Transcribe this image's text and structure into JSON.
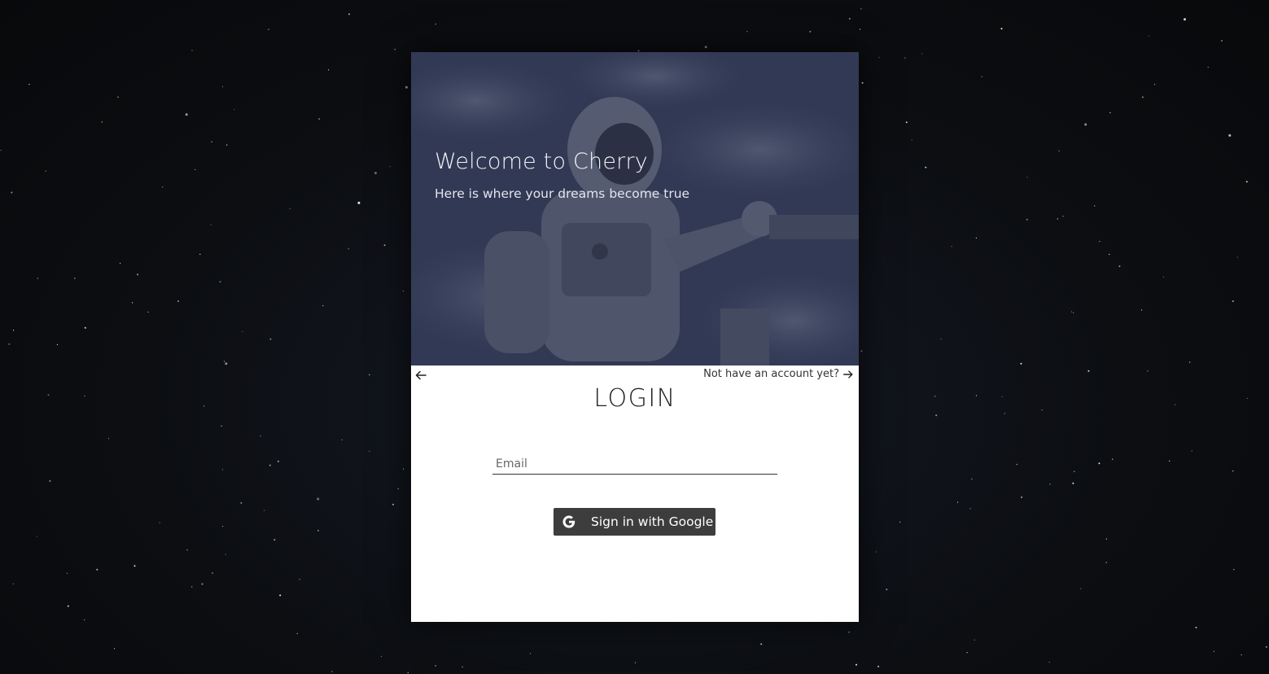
{
  "hero": {
    "title": "Welcome to Cherry",
    "subtitle": "Here is where your dreams become true"
  },
  "nav": {
    "back_icon": "arrow-left-icon",
    "signup_text": "Not have an account yet?",
    "signup_icon": "arrow-right-icon"
  },
  "login": {
    "title": "LOGIN",
    "email_placeholder": "Email",
    "email_value": "",
    "google_button_label": "Sign in with Google",
    "google_icon": "google-icon"
  },
  "colors": {
    "background": "#0c0e12",
    "card": "#ffffff",
    "google_button": "#3d3d3d",
    "hero_overlay": "#1e223a"
  }
}
